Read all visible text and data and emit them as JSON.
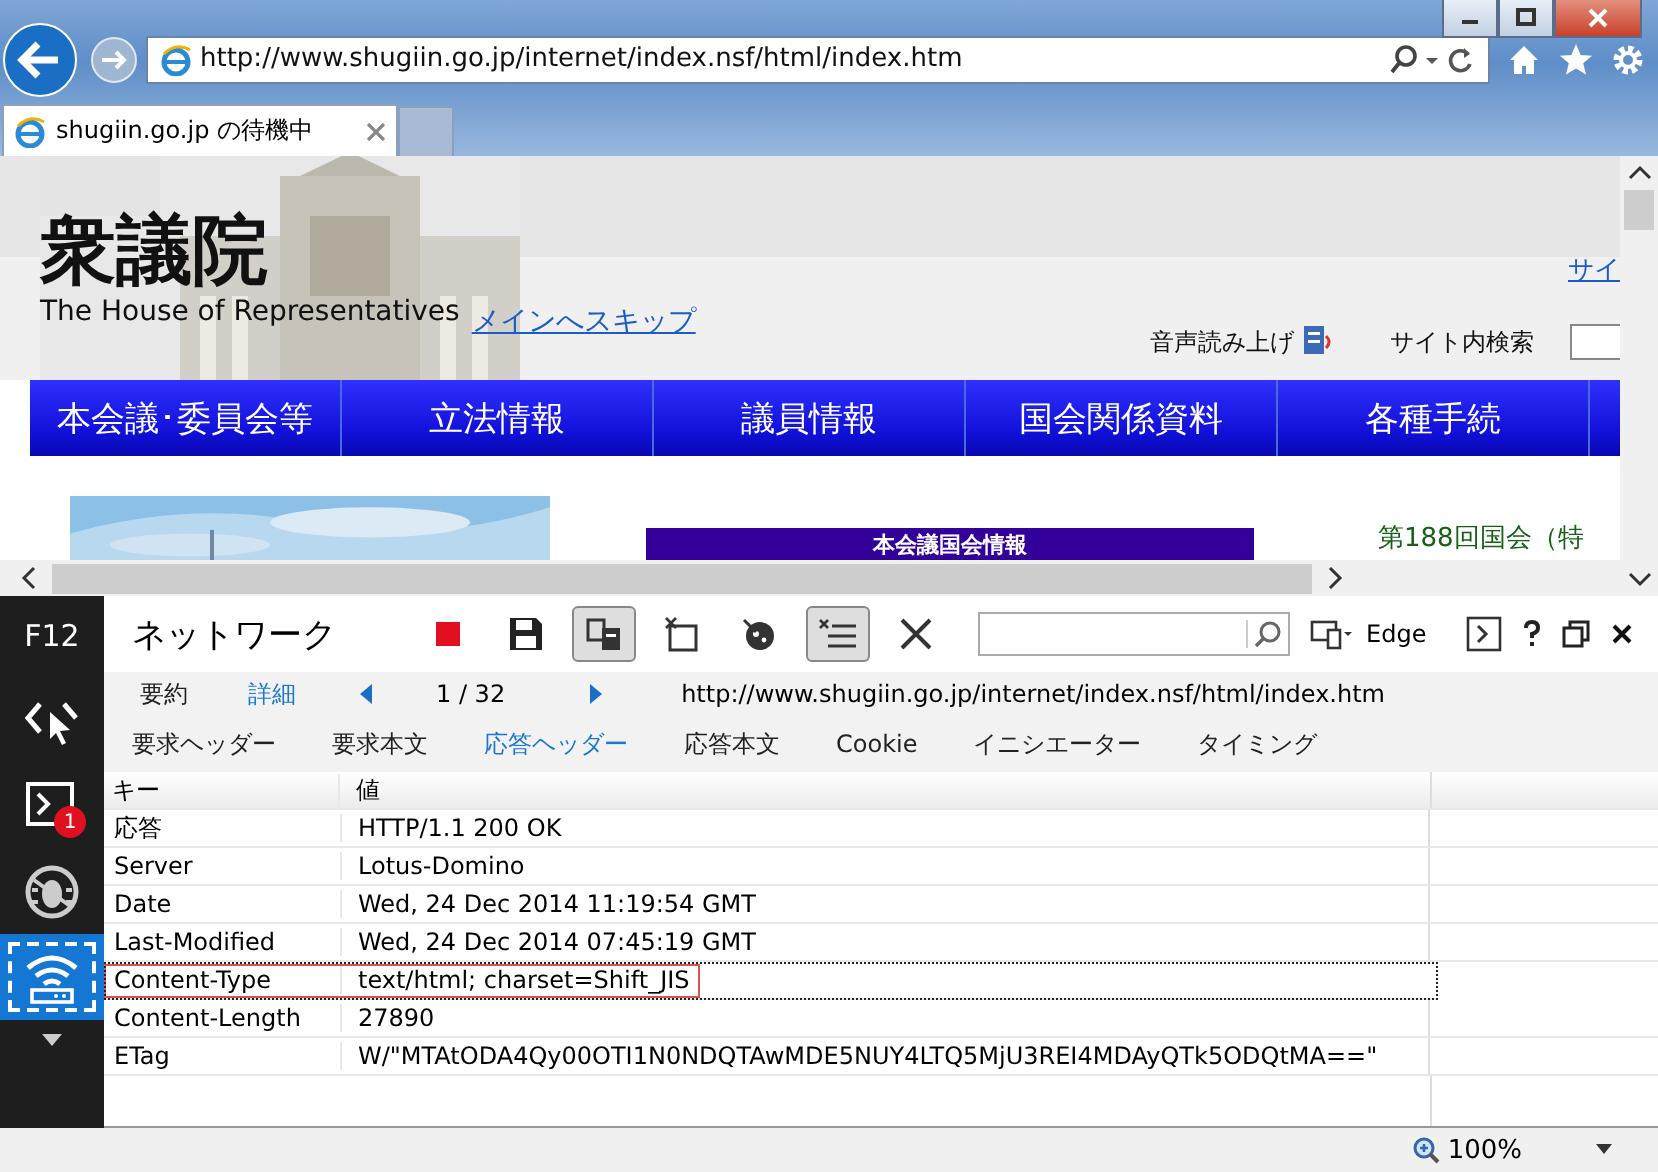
{
  "browser": {
    "url": "http://www.shugiin.go.jp/internet/index.nsf/html/index.htm",
    "tab_title": "shugiin.go.jp の待機中"
  },
  "page": {
    "logo_title": "衆議院",
    "logo_subtitle": "The House of Representatives",
    "skip_link": "メインへスキップ",
    "top_link": "サイ",
    "voice_read": "音声読み上げ",
    "site_search": "サイト内検索",
    "nav": [
      "本会議･委員会等",
      "立法情報",
      "議員情報",
      "国会関係資料",
      "各種手続"
    ],
    "news_heading": "本会議国会情報",
    "session": "第188回国会（特"
  },
  "devtools": {
    "f12_label": "F12",
    "title": "ネットワーク",
    "mode": "Edge",
    "sidebar": [
      {
        "kind": "dom",
        "selected": false
      },
      {
        "kind": "console",
        "selected": false,
        "badge": "1"
      },
      {
        "kind": "debugger",
        "selected": false
      },
      {
        "kind": "network",
        "selected": true
      }
    ],
    "subnav": [
      {
        "label": "要約",
        "selected": false
      },
      {
        "label": "詳細",
        "selected": true
      }
    ],
    "counter": "1 / 32",
    "request_url": "http://www.shugiin.go.jp/internet/index.nsf/html/index.htm",
    "tabs": [
      {
        "label": "要求ヘッダー",
        "selected": false
      },
      {
        "label": "要求本文",
        "selected": false
      },
      {
        "label": "応答ヘッダー",
        "selected": true
      },
      {
        "label": "応答本文",
        "selected": false
      },
      {
        "label": "Cookie",
        "selected": false
      },
      {
        "label": "イニシエーター",
        "selected": false
      },
      {
        "label": "タイミング",
        "selected": false
      }
    ],
    "columns": [
      "キー",
      "値"
    ],
    "rows": [
      {
        "key": "応答",
        "value": "HTTP/1.1 200 OK",
        "selected": false
      },
      {
        "key": "Server",
        "value": "Lotus-Domino",
        "selected": false
      },
      {
        "key": "Date",
        "value": "Wed, 24 Dec 2014 11:19:54 GMT",
        "selected": false
      },
      {
        "key": "Last-Modified",
        "value": "Wed, 24 Dec 2014 07:45:19 GMT",
        "selected": false
      },
      {
        "key": "Content-Type",
        "value": "text/html; charset=Shift_JIS",
        "selected": true
      },
      {
        "key": "Content-Length",
        "value": "27890",
        "selected": false
      },
      {
        "key": "ETag",
        "value": "W/\"MTAtODA4Qy00OTI1N0NDQTAwMDE5NUY4LTQ5MjU3REI4MDAyQTk5ODQtMA==\"",
        "selected": false
      }
    ],
    "zoom": "100%"
  }
}
